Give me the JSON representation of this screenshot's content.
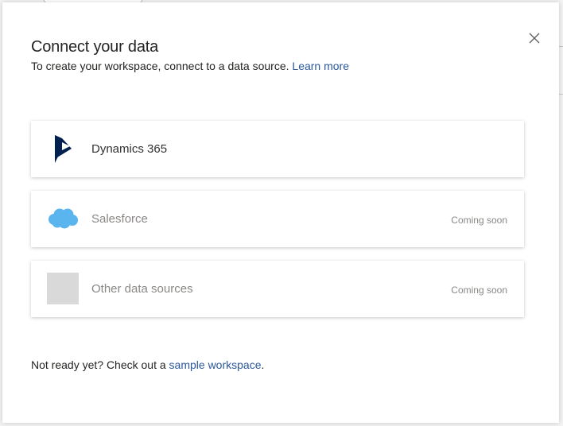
{
  "dialog": {
    "title": "Connect your data",
    "subtitle": "To create your workspace, connect to a data source.",
    "learn_more": "Learn more",
    "close_icon": "close-icon"
  },
  "sources": [
    {
      "label": "Dynamics 365",
      "status": "",
      "icon": "dynamics-365-logo",
      "enabled": true
    },
    {
      "label": "Salesforce",
      "status": "Coming soon",
      "icon": "salesforce-cloud-logo",
      "enabled": false
    },
    {
      "label": "Other data sources",
      "status": "Coming soon",
      "icon": "placeholder-logo",
      "enabled": false
    }
  ],
  "footer": {
    "prefix": "Not ready yet? Check out a",
    "link": "sample workspace",
    "suffix": "."
  },
  "colors": {
    "link": "#2b579a",
    "dynamics": "#002050",
    "salesforce": "#5ab4ee",
    "placeholder": "#d9d9d9"
  }
}
